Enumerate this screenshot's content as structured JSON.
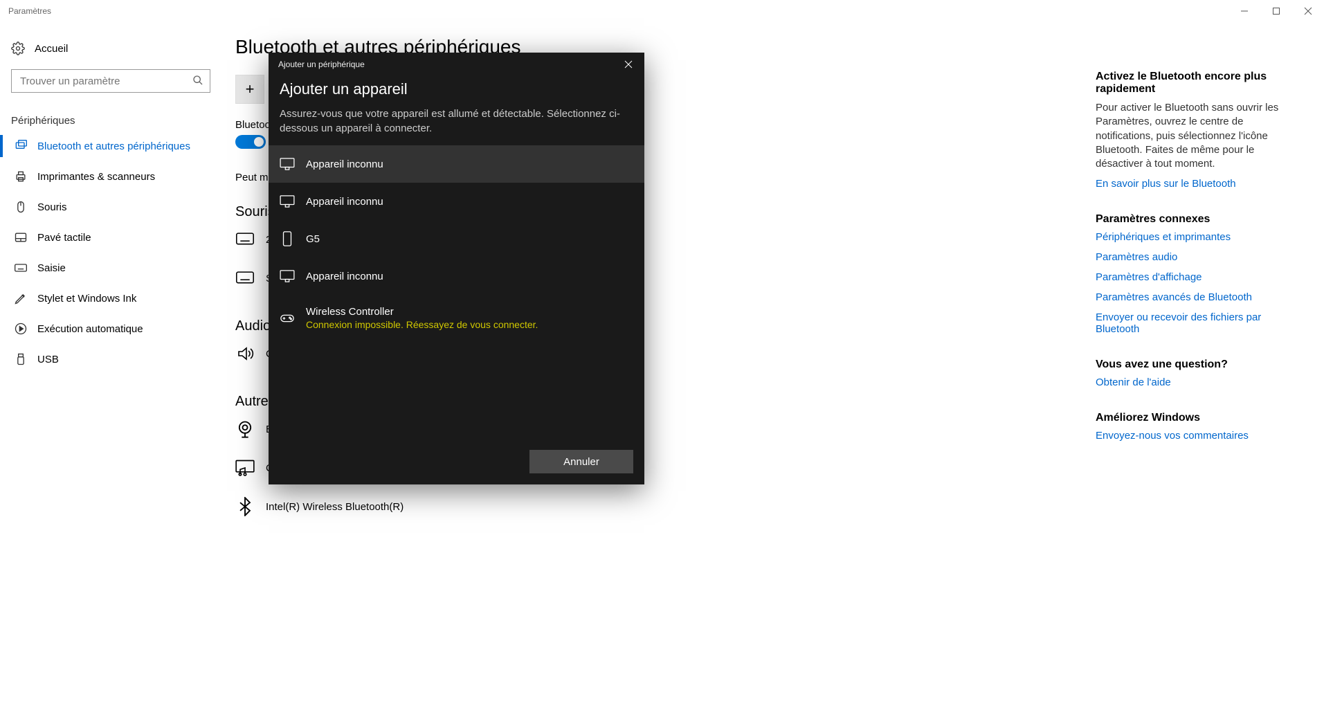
{
  "window": {
    "title": "Paramètres"
  },
  "sidebar": {
    "home": "Accueil",
    "search_placeholder": "Trouver un paramètre",
    "section": "Périphériques",
    "items": [
      {
        "label": "Bluetooth et autres périphériques",
        "icon": "bluetooth-devices-icon",
        "active": true
      },
      {
        "label": "Imprimantes & scanneurs",
        "icon": "printer-icon"
      },
      {
        "label": "Souris",
        "icon": "mouse-icon"
      },
      {
        "label": "Pavé tactile",
        "icon": "touchpad-icon"
      },
      {
        "label": "Saisie",
        "icon": "keyboard-icon"
      },
      {
        "label": "Stylet et Windows Ink",
        "icon": "pen-icon"
      },
      {
        "label": "Exécution automatique",
        "icon": "autoplay-icon"
      },
      {
        "label": "USB",
        "icon": "usb-icon"
      }
    ]
  },
  "main": {
    "page_title": "Bluetooth et autres périphériques",
    "bluetooth_label_truncated": "Bluetoo",
    "discoverable_truncated": "Peut ma",
    "section_mouse": "Souris",
    "mouse_letter": "2",
    "mouse_letter2": "S",
    "section_audio": "Audio",
    "audio_letter": "C",
    "section_other": "Autres",
    "other_letter": "E",
    "devices": {
      "chrome": "ChromeRaph",
      "bt_adapter": "Intel(R) Wireless Bluetooth(R)"
    }
  },
  "right": {
    "tip_title": "Activez le Bluetooth encore plus rapidement",
    "tip_body": "Pour activer le Bluetooth sans ouvrir les Paramètres, ouvrez le centre de notifications, puis sélectionnez l'icône Bluetooth. Faites de même pour le désactiver à tout moment.",
    "tip_link": "En savoir plus sur le Bluetooth",
    "related_title": "Paramètres connexes",
    "related_links": [
      "Périphériques et imprimantes",
      "Paramètres audio",
      "Paramètres d'affichage",
      "Paramètres avancés de Bluetooth",
      "Envoyer ou recevoir des fichiers par Bluetooth"
    ],
    "question_title": "Vous avez une question?",
    "question_link": "Obtenir de l'aide",
    "improve_title": "Améliorez Windows",
    "improve_link": "Envoyez-nous vos commentaires"
  },
  "dialog": {
    "title": "Ajouter un périphérique",
    "heading": "Ajouter un appareil",
    "subtitle": "Assurez-vous que votre appareil est allumé et détectable. Sélectionnez ci-dessous un appareil à connecter.",
    "devices": [
      {
        "name": "Appareil inconnu",
        "icon": "display-icon",
        "hover": true
      },
      {
        "name": "Appareil inconnu",
        "icon": "display-icon"
      },
      {
        "name": "G5",
        "icon": "phone-icon"
      },
      {
        "name": "Appareil inconnu",
        "icon": "display-icon"
      },
      {
        "name": "Wireless Controller",
        "icon": "gamepad-icon",
        "error": "Connexion impossible. Réessayez de vous connecter."
      }
    ],
    "cancel": "Annuler"
  }
}
